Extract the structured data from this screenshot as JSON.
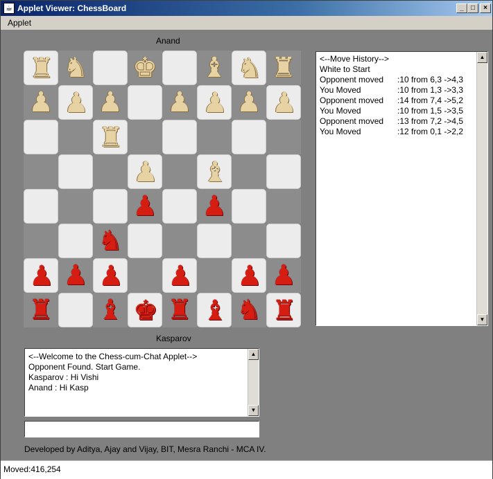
{
  "window": {
    "title": "Applet Viewer: ChessBoard",
    "minimize": "_",
    "maximize": "□",
    "close": "×",
    "icon": "☕"
  },
  "menu": {
    "applet": "Applet"
  },
  "players": {
    "top": "Anand",
    "bottom": "Kasparov"
  },
  "board": {
    "rows": [
      [
        "wR",
        "wN",
        "",
        "wK",
        "",
        "wB",
        "wN",
        "wR"
      ],
      [
        "wP",
        "wP",
        "wP",
        "",
        "wP",
        "wP",
        "wP",
        "wP"
      ],
      [
        "",
        "",
        "wR",
        "",
        "",
        "",
        "",
        ""
      ],
      [
        "",
        "",
        "",
        "wP",
        "",
        "wB",
        "",
        ""
      ],
      [
        "",
        "",
        "",
        "bP",
        "",
        "bP",
        "",
        ""
      ],
      [
        "",
        "",
        "bN",
        "",
        "",
        "",
        "",
        ""
      ],
      [
        "bP",
        "bP",
        "bP",
        "",
        "bP",
        "",
        "bP",
        "bP"
      ],
      [
        "bR",
        "",
        "bB",
        "bK",
        "bR",
        "bB",
        "bN",
        "bR"
      ]
    ]
  },
  "history": {
    "lines": [
      [
        "<--Move History-->",
        ""
      ],
      [
        "White to Start",
        ""
      ],
      [
        "Opponent moved",
        ":10 from 6,3 ->4,3"
      ],
      [
        "You Moved",
        ":10 from 1,3 ->3,3"
      ],
      [
        "Opponent moved",
        ":14 from 7,4 ->5,2"
      ],
      [
        "You Moved",
        ":10 from 1,5 ->3,5"
      ],
      [
        "Opponent moved",
        ":13 from 7,2 ->4,5"
      ],
      [
        "You Moved",
        ":12 from 0,1 ->2,2"
      ]
    ]
  },
  "chat": {
    "lines": [
      "<--Welcome to the Chess-cum-Chat Applet-->",
      "Opponent Found. Start Game.",
      "Kasparov : Hi Vishi",
      "Anand : Hi Kasp"
    ],
    "input_value": ""
  },
  "credits": "Developed by Aditya, Ajay and Vijay, BIT, Mesra Ranchi - MCA IV.",
  "status": "Moved:416,254"
}
